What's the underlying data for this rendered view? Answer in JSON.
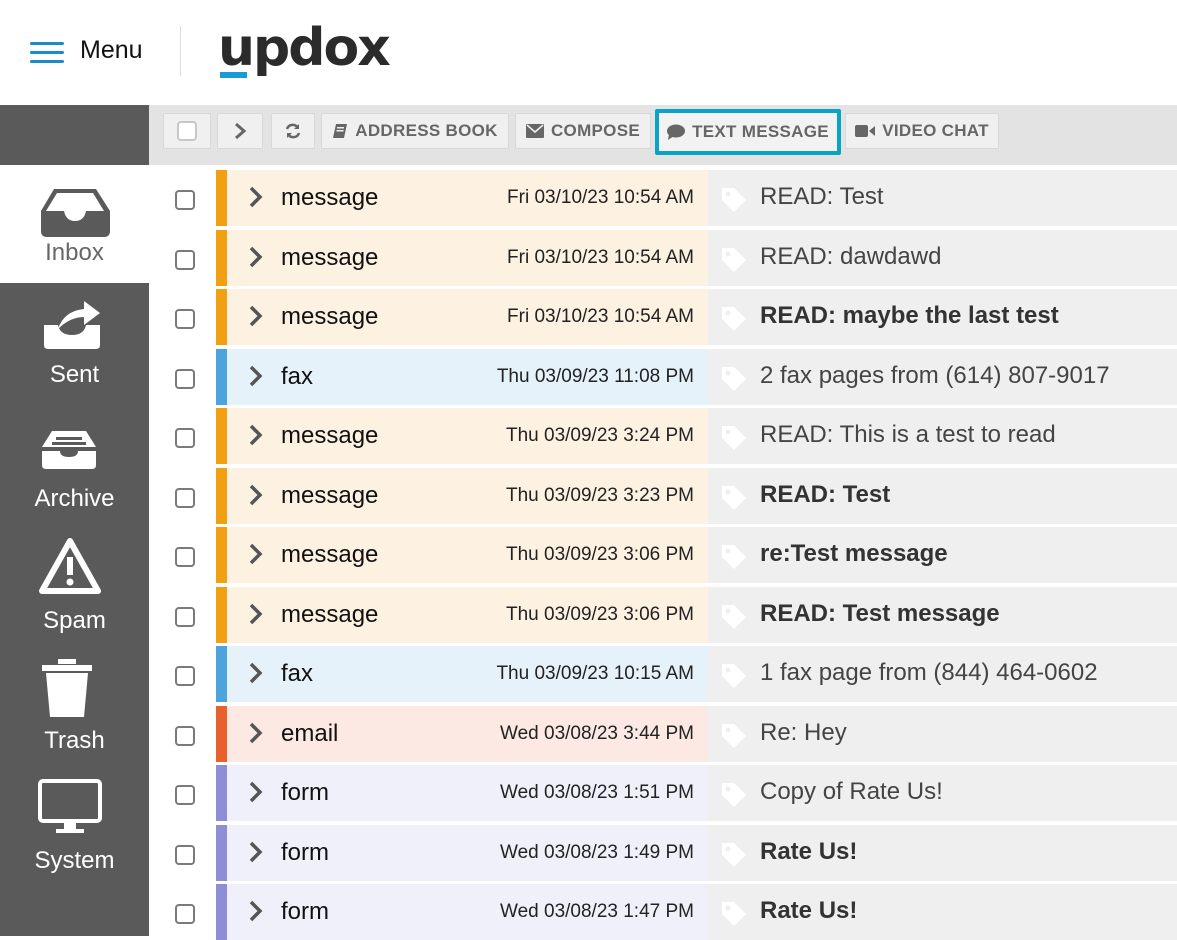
{
  "header": {
    "menu_label": "Menu",
    "logo_text": "updox"
  },
  "sidebar": {
    "items": [
      {
        "label": "Inbox",
        "icon": "inbox-icon",
        "active": true
      },
      {
        "label": "Sent",
        "icon": "sent-icon"
      },
      {
        "label": "Archive",
        "icon": "archive-icon"
      },
      {
        "label": "Spam",
        "icon": "spam-warning-icon"
      },
      {
        "label": "Trash",
        "icon": "trash-icon"
      },
      {
        "label": "System",
        "icon": "monitor-icon"
      }
    ]
  },
  "toolbar": {
    "address_book": "ADDRESS BOOK",
    "compose": "COMPOSE",
    "text_message": "TEXT MESSAGE",
    "video_chat": "VIDEO CHAT"
  },
  "colors": {
    "message": "#f0a010",
    "fax": "#4da3dc",
    "email": "#e8602c",
    "form": "#8e8ed6",
    "highlight": "#0aa3c7"
  },
  "messages": [
    {
      "type": "message",
      "date": "Fri 03/10/23 10:54 AM",
      "subject": "READ: Test",
      "unread": false
    },
    {
      "type": "message",
      "date": "Fri 03/10/23 10:54 AM",
      "subject": "READ: dawdawd",
      "unread": false
    },
    {
      "type": "message",
      "date": "Fri 03/10/23 10:54 AM",
      "subject": "READ: maybe the last test",
      "unread": true
    },
    {
      "type": "fax",
      "date": "Thu 03/09/23 11:08 PM",
      "subject": "2 fax pages from (614) 807-9017",
      "unread": false
    },
    {
      "type": "message",
      "date": "Thu 03/09/23 3:24 PM",
      "subject": "READ: This is a test to read",
      "unread": false
    },
    {
      "type": "message",
      "date": "Thu 03/09/23 3:23 PM",
      "subject": "READ: Test",
      "unread": true
    },
    {
      "type": "message",
      "date": "Thu 03/09/23 3:06 PM",
      "subject": "re:Test message",
      "unread": true
    },
    {
      "type": "message",
      "date": "Thu 03/09/23 3:06 PM",
      "subject": "READ: Test message",
      "unread": true
    },
    {
      "type": "fax",
      "date": "Thu 03/09/23 10:15 AM",
      "subject": "1 fax page from (844) 464-0602",
      "unread": false
    },
    {
      "type": "email",
      "date": "Wed 03/08/23 3:44 PM",
      "subject": "Re: Hey",
      "unread": false
    },
    {
      "type": "form",
      "date": "Wed 03/08/23 1:51 PM",
      "subject": "Copy of Rate Us!",
      "unread": false
    },
    {
      "type": "form",
      "date": "Wed 03/08/23 1:49 PM",
      "subject": "Rate Us!",
      "unread": true
    },
    {
      "type": "form",
      "date": "Wed 03/08/23 1:47 PM",
      "subject": "Rate Us!",
      "unread": true
    }
  ]
}
